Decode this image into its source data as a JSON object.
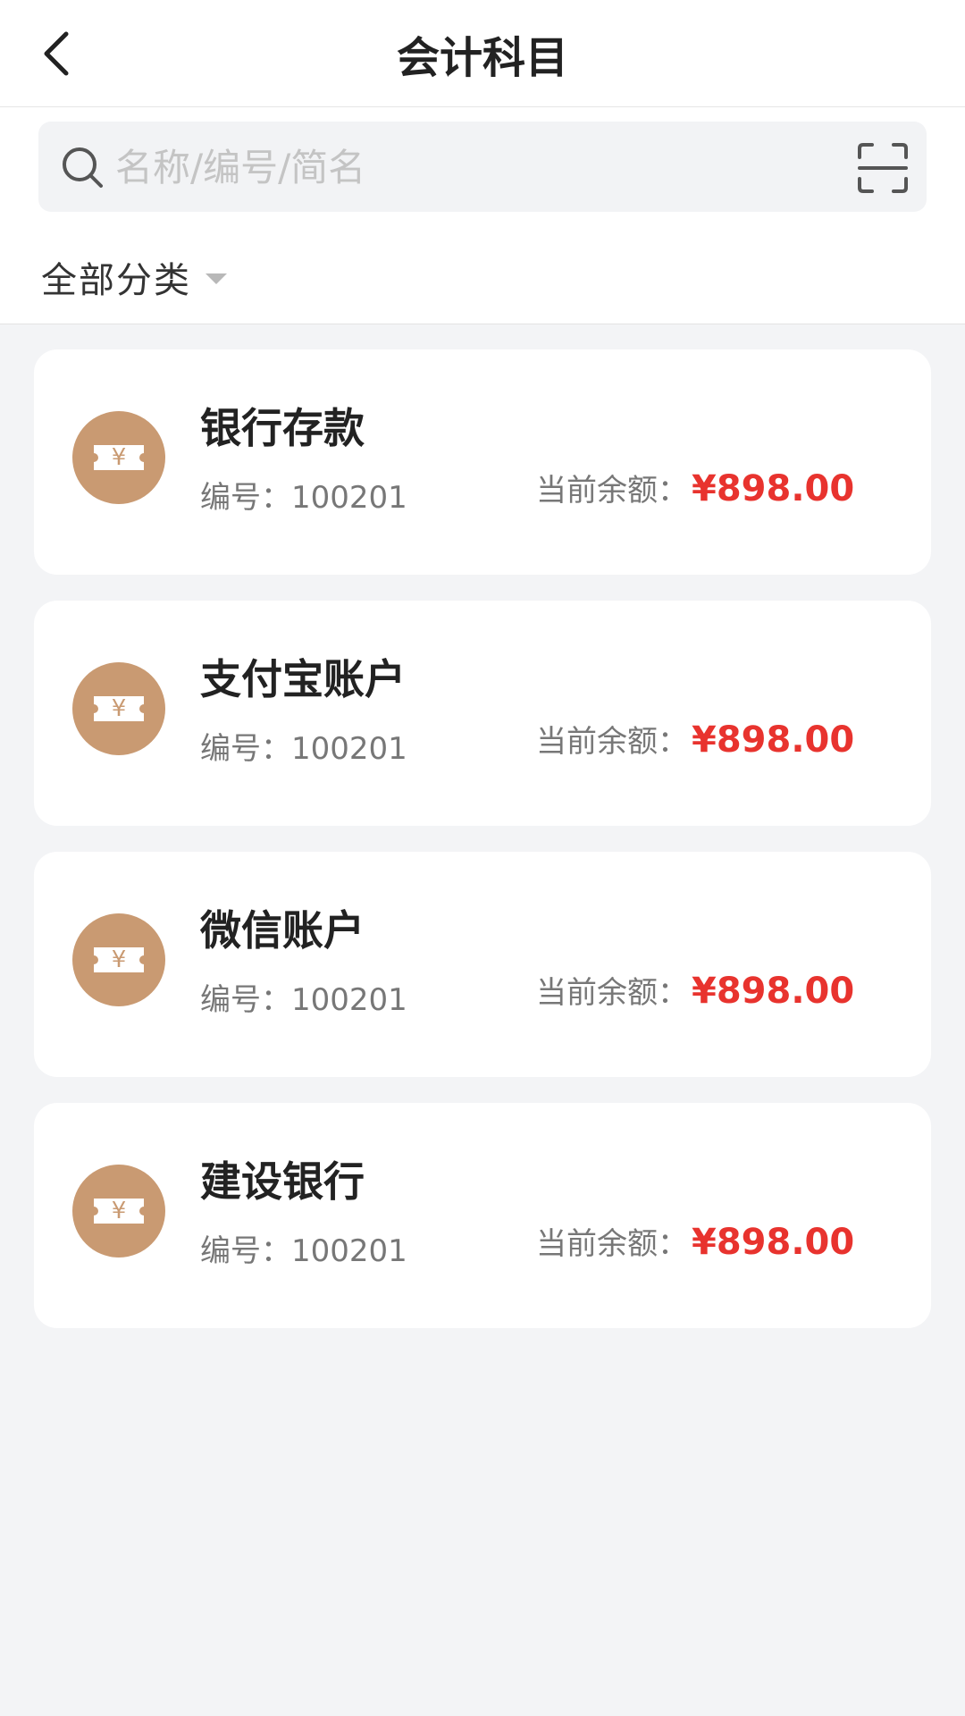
{
  "header": {
    "title": "会计科目"
  },
  "search": {
    "placeholder": "名称/编号/简名"
  },
  "filter": {
    "label": "全部分类"
  },
  "colors": {
    "accent": "#e8332e",
    "icon_bg": "#c99a72"
  },
  "accounts": [
    {
      "name": "银行存款",
      "code": "编号：100201",
      "balance_label": "当前余额：",
      "balance": "¥898.00"
    },
    {
      "name": "支付宝账户",
      "code": "编号：100201",
      "balance_label": "当前余额：",
      "balance": "¥898.00"
    },
    {
      "name": "微信账户",
      "code": "编号：100201",
      "balance_label": "当前余额：",
      "balance": "¥898.00"
    },
    {
      "name": "建设银行",
      "code": "编号：100201",
      "balance_label": "当前余额：",
      "balance": "¥898.00"
    }
  ]
}
